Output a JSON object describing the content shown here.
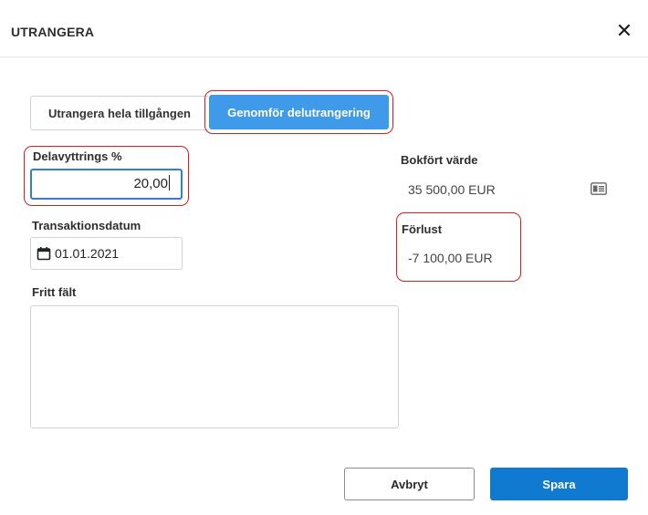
{
  "dialog": {
    "title": "UTRANGERA",
    "close_glyph": "✕"
  },
  "mode_toggle": {
    "options": [
      {
        "label": "Utrangera hela tillgången",
        "selected": false
      },
      {
        "label": "Genomför delutrangering",
        "selected": true
      }
    ]
  },
  "form": {
    "partial_percent": {
      "label": "Delavyttrings %",
      "value": "20,00"
    },
    "transaction_date": {
      "label": "Transaktionsdatum",
      "value": "01.01.2021",
      "icon": "calendar-icon"
    },
    "free_field": {
      "label": "Fritt fält",
      "value": ""
    }
  },
  "summary": {
    "book_value": {
      "label": "Bokfört värde",
      "value": "35 500,00 EUR",
      "icon": "id-card-icon"
    },
    "loss": {
      "label": "Förlust",
      "value": "-7 100,00 EUR"
    }
  },
  "footer": {
    "cancel_label": "Avbryt",
    "save_label": "Spara"
  },
  "colors": {
    "primary": "#0f7ad0",
    "selected_toggle": "#3f9ae9",
    "focus_border": "#2f7de1",
    "annotation_red": "#d81e1e"
  }
}
